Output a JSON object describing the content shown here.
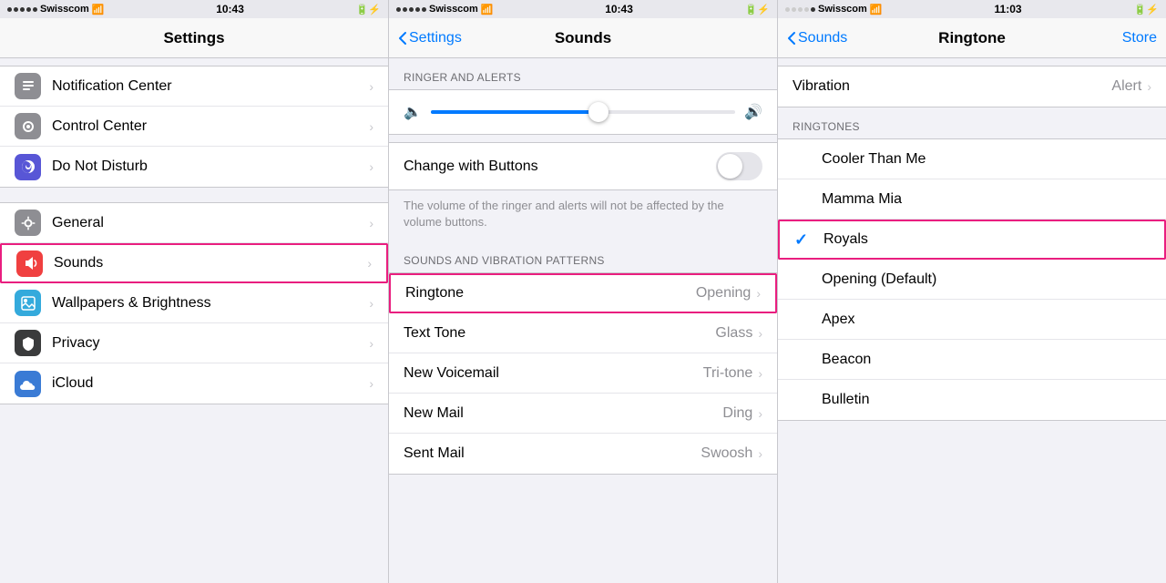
{
  "panel1": {
    "status": {
      "carrier": "Swisscom",
      "time": "10:43",
      "wifi": true,
      "charging": true
    },
    "title": "Settings",
    "items": [
      {
        "id": "notification-center",
        "label": "Notification Center",
        "iconBg": "#8e8e93",
        "iconType": "notif"
      },
      {
        "id": "control-center",
        "label": "Control Center",
        "iconBg": "#8e8e93",
        "iconType": "control"
      },
      {
        "id": "do-not-disturb",
        "label": "Do Not Disturb",
        "iconBg": "#5856d6",
        "iconType": "dnd"
      },
      {
        "id": "general",
        "label": "General",
        "iconBg": "#8e8e93",
        "iconType": "general"
      },
      {
        "id": "sounds",
        "label": "Sounds",
        "iconBg": "#f04040",
        "iconType": "sounds",
        "highlighted": true
      },
      {
        "id": "wallpapers-brightness",
        "label": "Wallpapers & Brightness",
        "iconBg": "#34aadc",
        "iconType": "wallpaper"
      },
      {
        "id": "privacy",
        "label": "Privacy",
        "iconBg": "#3a3b3c",
        "iconType": "privacy"
      },
      {
        "id": "icloud",
        "label": "iCloud",
        "iconBg": "#3a7bd5",
        "iconType": "icloud"
      }
    ]
  },
  "panel2": {
    "status": {
      "carrier": "Swisscom",
      "time": "10:43",
      "wifi": true,
      "charging": true
    },
    "back_label": "Settings",
    "title": "Sounds",
    "section_ringer": "RINGER AND ALERTS",
    "change_with_buttons_label": "Change with Buttons",
    "toggle_hint": "The volume of the ringer and alerts will not be affected by the volume buttons.",
    "section_patterns": "SOUNDS AND VIBRATION PATTERNS",
    "items": [
      {
        "id": "ringtone",
        "label": "Ringtone",
        "value": "Opening",
        "highlighted": true
      },
      {
        "id": "text-tone",
        "label": "Text Tone",
        "value": "Glass"
      },
      {
        "id": "new-voicemail",
        "label": "New Voicemail",
        "value": "Tri-tone"
      },
      {
        "id": "new-mail",
        "label": "New Mail",
        "value": "Ding"
      },
      {
        "id": "sent-mail",
        "label": "Sent Mail",
        "value": "Swoosh"
      }
    ]
  },
  "panel3": {
    "status": {
      "carrier": "Swisscom",
      "time": "11:03",
      "wifi": true,
      "charging": true
    },
    "back_label": "Sounds",
    "title": "Ringtone",
    "store_label": "Store",
    "vibration_label": "Vibration",
    "vibration_value": "Alert",
    "section_ringtones": "RINGTONES",
    "ringtones": [
      {
        "id": "cooler-than-me",
        "label": "Cooler Than Me",
        "selected": false
      },
      {
        "id": "mamma-mia",
        "label": "Mamma Mia",
        "selected": false
      },
      {
        "id": "royals",
        "label": "Royals",
        "selected": true,
        "highlighted": true
      },
      {
        "id": "opening-default",
        "label": "Opening (Default)",
        "selected": false
      },
      {
        "id": "apex",
        "label": "Apex",
        "selected": false
      },
      {
        "id": "beacon",
        "label": "Beacon",
        "selected": false
      },
      {
        "id": "bulletin",
        "label": "Bulletin",
        "selected": false
      }
    ]
  }
}
